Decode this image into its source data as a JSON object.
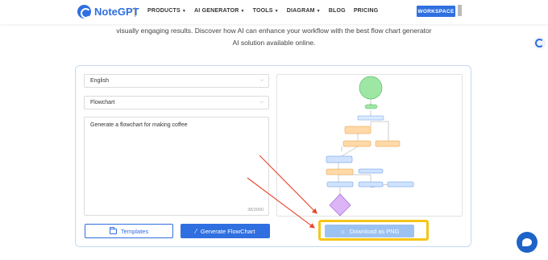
{
  "header": {
    "brand": "NoteGPT",
    "nav": [
      {
        "label": "PRODUCTS",
        "caret": true
      },
      {
        "label": "AI GENERATOR",
        "caret": true
      },
      {
        "label": "TOOLS",
        "caret": true
      },
      {
        "label": "DIAGRAM",
        "caret": true
      },
      {
        "label": "BLOG",
        "caret": false
      },
      {
        "label": "PRICING",
        "caret": false
      }
    ],
    "workspace_label": "WORKSPACE"
  },
  "intro": {
    "line1": "visually engaging results. Discover how AI can enhance your workflow with the best flow chart generator",
    "line2": "AI solution available online."
  },
  "form": {
    "language": "English",
    "chart_type": "Flowchart",
    "prompt": "Generate a flowchart for making coffee",
    "counter": "38/3000"
  },
  "buttons": {
    "templates": "Templates",
    "generate": "Generate FlowChart",
    "download": "Download as PNG"
  },
  "colors": {
    "brand": "#2f6fe0",
    "highlight": "#f5c518",
    "arrow": "#e8452c"
  }
}
